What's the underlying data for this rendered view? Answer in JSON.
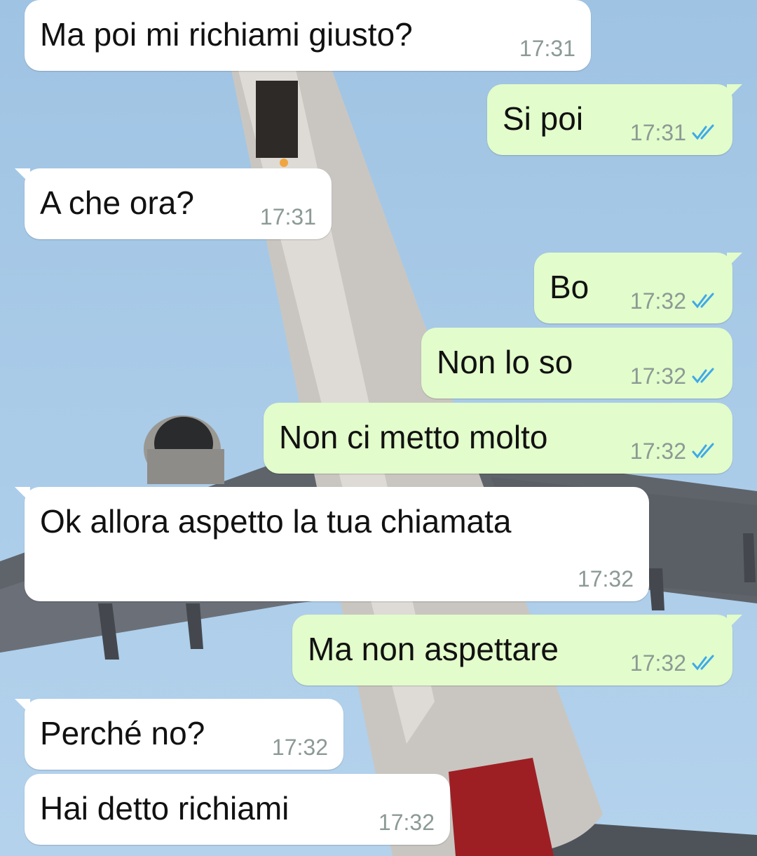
{
  "wallpaper": {
    "description_icon": "airplane-wallpaper-icon"
  },
  "colors": {
    "incoming": "#ffffff",
    "outgoing": "#e2fccb",
    "tick_read": "#3fa9e8",
    "time_text": "#8c9a95"
  },
  "messages": [
    {
      "dir": "in",
      "text": "Ma poi mi richiami giusto?",
      "time": "17:31"
    },
    {
      "dir": "out",
      "text": "Si poi",
      "time": "17:31",
      "status": "read"
    },
    {
      "dir": "in",
      "text": "A che ora?",
      "time": "17:31"
    },
    {
      "dir": "out",
      "text": "Bo",
      "time": "17:32",
      "status": "read"
    },
    {
      "dir": "out",
      "text": "Non lo so",
      "time": "17:32",
      "status": "read"
    },
    {
      "dir": "out",
      "text": "Non ci metto molto",
      "time": "17:32",
      "status": "read"
    },
    {
      "dir": "in",
      "text": "Ok allora aspetto la tua chiamata",
      "time": "17:32"
    },
    {
      "dir": "out",
      "text": "Ma non aspettare",
      "time": "17:32",
      "status": "read"
    },
    {
      "dir": "in",
      "text": "Perché no?",
      "time": "17:32"
    },
    {
      "dir": "in",
      "text": "Hai detto richiami",
      "time": "17:32"
    }
  ]
}
